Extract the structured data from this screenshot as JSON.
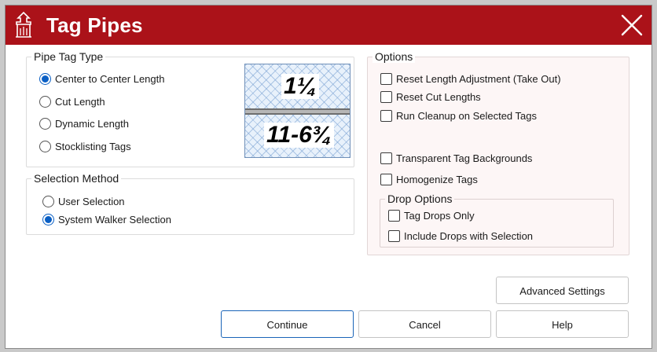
{
  "window": {
    "title": "Tag Pipes"
  },
  "pipe_tag_type": {
    "legend": "Pipe Tag Type",
    "options": [
      {
        "label": "Center to Center Length",
        "checked": true
      },
      {
        "label": "Cut Length",
        "checked": false
      },
      {
        "label": "Dynamic Length",
        "checked": false
      },
      {
        "label": "Stocklisting Tags",
        "checked": false
      }
    ],
    "preview": {
      "top_tag": "1¼",
      "bottom_tag": "11-6¾"
    }
  },
  "selection_method": {
    "legend": "Selection Method",
    "options": [
      {
        "label": "User Selection",
        "checked": false
      },
      {
        "label": "System Walker Selection",
        "checked": true
      }
    ]
  },
  "options": {
    "legend": "Options",
    "checks": [
      {
        "label": "Reset Length Adjustment (Take Out)",
        "checked": false
      },
      {
        "label": "Reset Cut Lengths",
        "checked": false
      },
      {
        "label": "Run Cleanup on Selected Tags",
        "checked": false
      },
      {
        "label": "Transparent Tag Backgrounds",
        "checked": false
      },
      {
        "label": "Homogenize Tags",
        "checked": false
      }
    ],
    "drop_options": {
      "legend": "Drop Options",
      "checks": [
        {
          "label": "Tag Drops Only",
          "checked": false
        },
        {
          "label": "Include Drops with Selection",
          "checked": false
        }
      ]
    }
  },
  "buttons": {
    "advanced": "Advanced Settings",
    "continue": "Continue",
    "cancel": "Cancel",
    "help": "Help"
  },
  "colors": {
    "title_bar": "#ab1219",
    "radio_accent": "#0a5fc4"
  }
}
